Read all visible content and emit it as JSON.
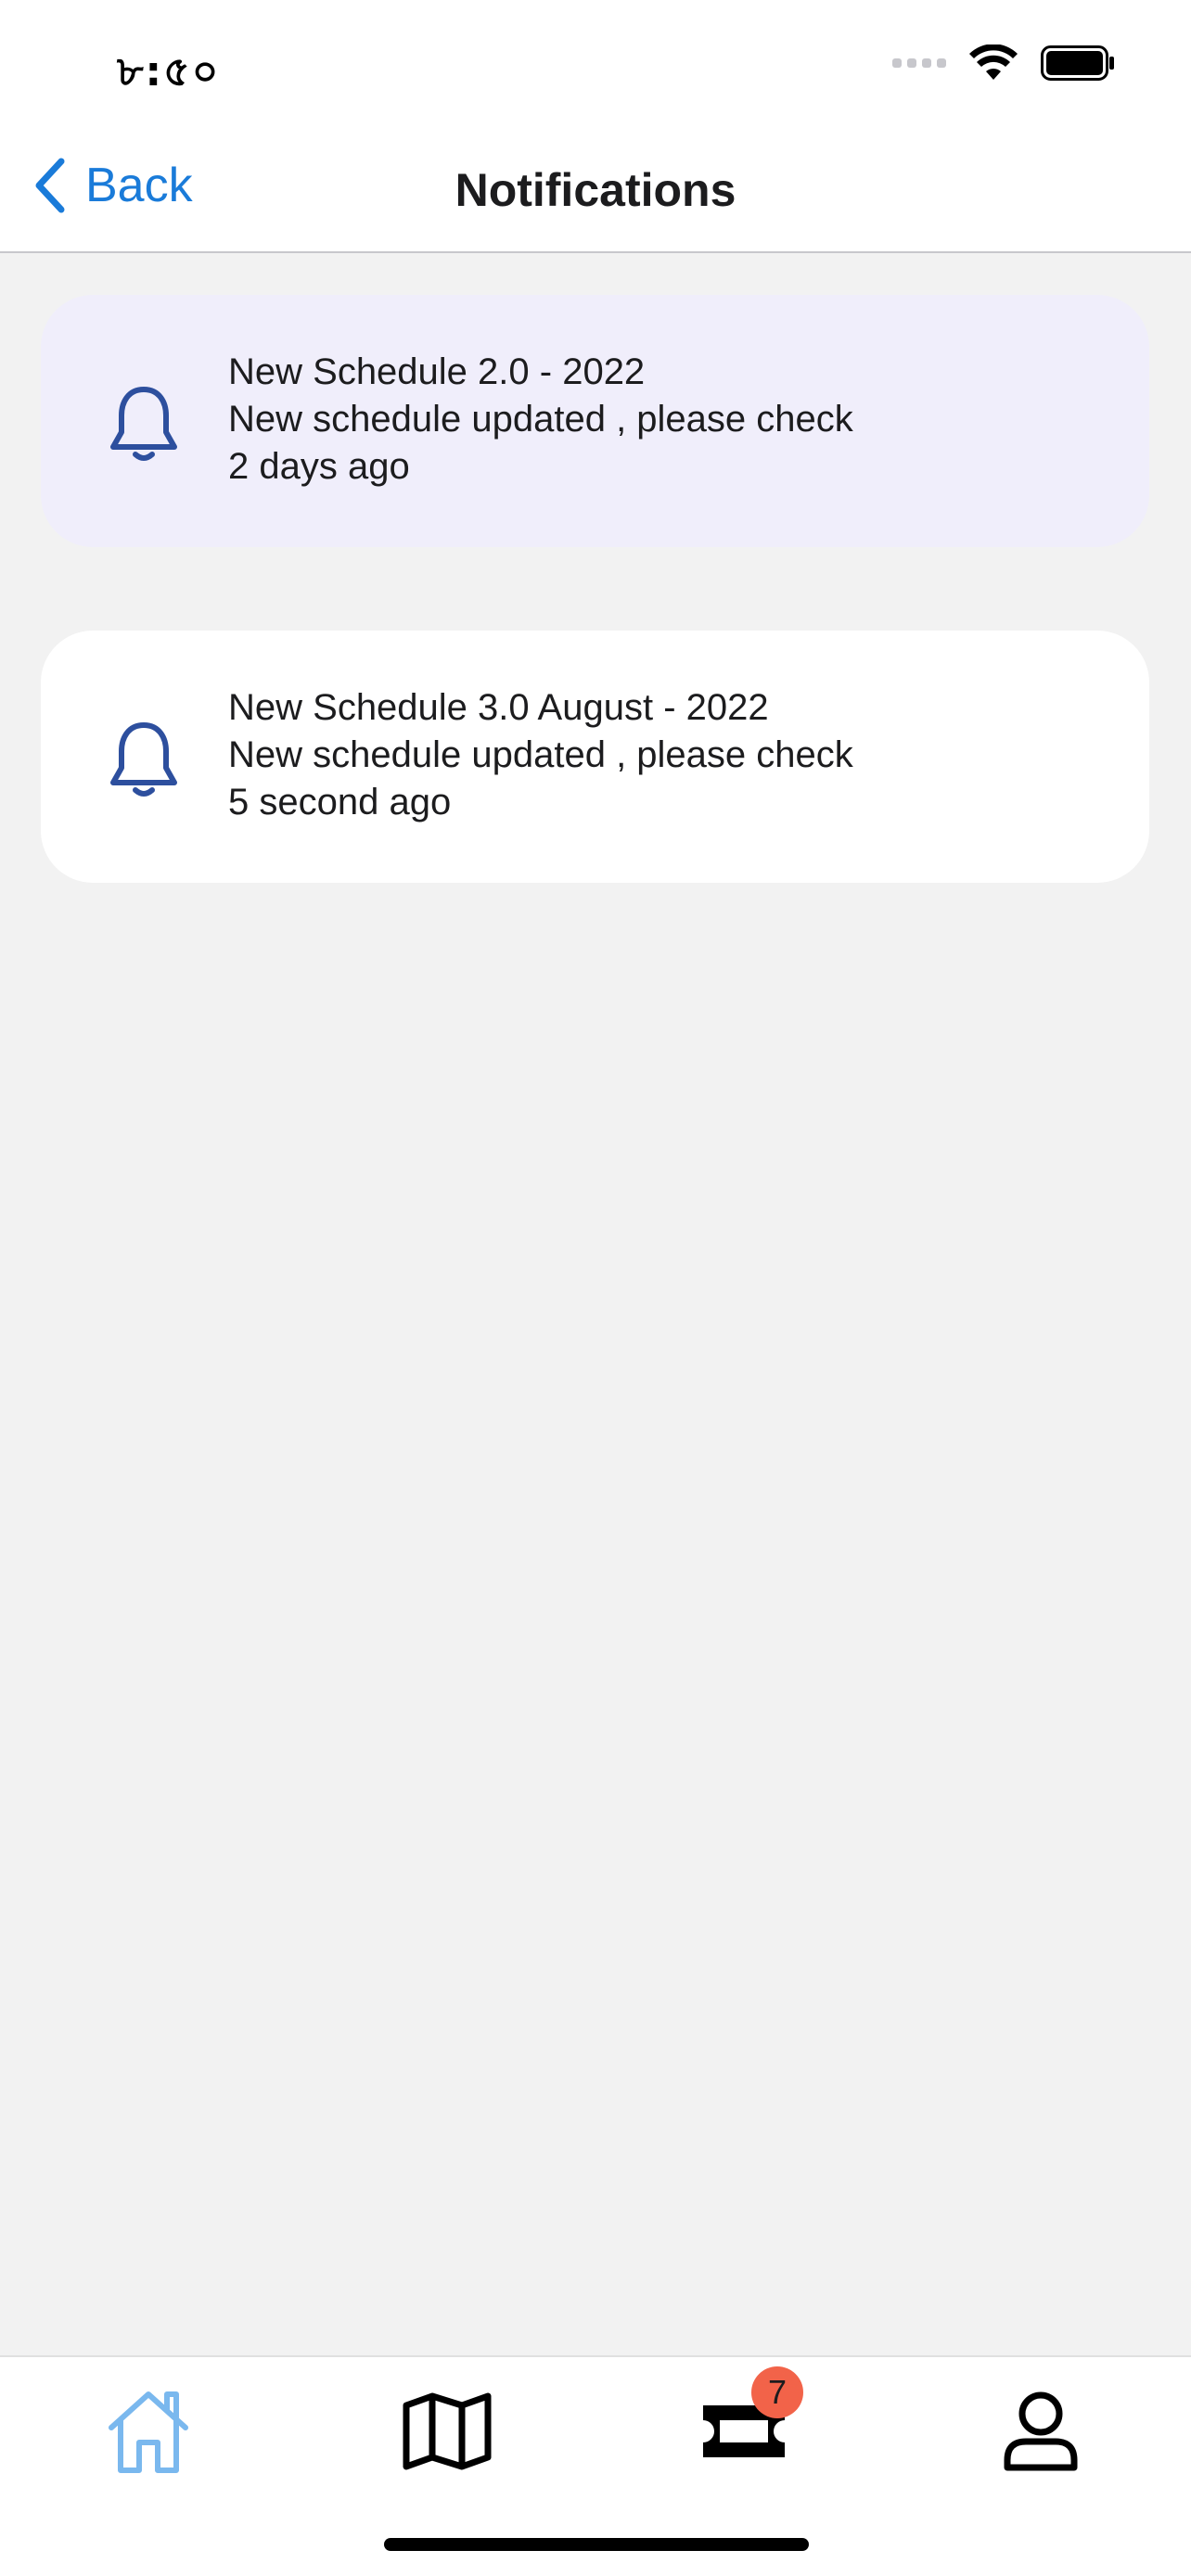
{
  "status_bar": {
    "time": "৮:৫০"
  },
  "nav": {
    "back_label": "Back",
    "title": "Notifications"
  },
  "notifications": [
    {
      "title": "New Schedule 2.0 - 2022",
      "message": "New schedule updated , please check",
      "time": "2 days ago",
      "state": "unread"
    },
    {
      "title": "New Schedule 3.0 August - 2022",
      "message": "New schedule updated , please check",
      "time": "5 second ago",
      "state": "read"
    }
  ],
  "tab_bar": {
    "tickets_badge": "7",
    "active_color": "#7ab8ee",
    "icon_color": "#000000"
  },
  "colors": {
    "accent": "#1a7bd9",
    "bell": "#2d4f9e",
    "badge": "#f26349",
    "unread_card": "#f0eefb"
  }
}
